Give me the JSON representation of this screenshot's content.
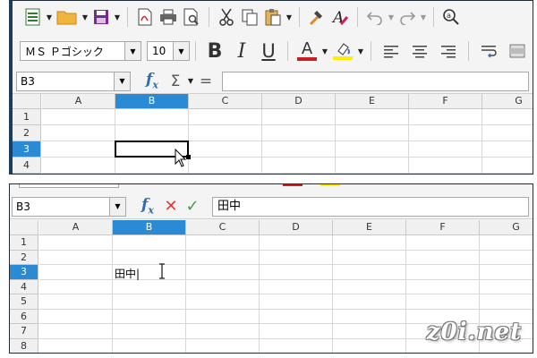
{
  "toolbar": {
    "font_name": "ＭＳ Ｐゴシック",
    "font_size": "10"
  },
  "top": {
    "name_box": "B3",
    "formula_value": "",
    "columns": [
      "A",
      "B",
      "C",
      "D",
      "E",
      "F",
      "G"
    ],
    "rows": [
      "1",
      "2",
      "3",
      "4"
    ],
    "selected_col": "B",
    "selected_row": "3"
  },
  "bottom": {
    "name_box": "B3",
    "formula_value": "田中",
    "cell_text": "田中",
    "columns": [
      "A",
      "B",
      "C",
      "D",
      "E",
      "F",
      "G"
    ],
    "rows": [
      "1",
      "2",
      "3",
      "4",
      "5",
      "6",
      "7",
      "8"
    ],
    "selected_col": "B",
    "selected_row": "3"
  },
  "watermark": "z0i.net",
  "colors": {
    "selection_header": "#2a8ad4",
    "font_color_bar": "#c81e1e",
    "highlight_bar": "#ffee00"
  }
}
